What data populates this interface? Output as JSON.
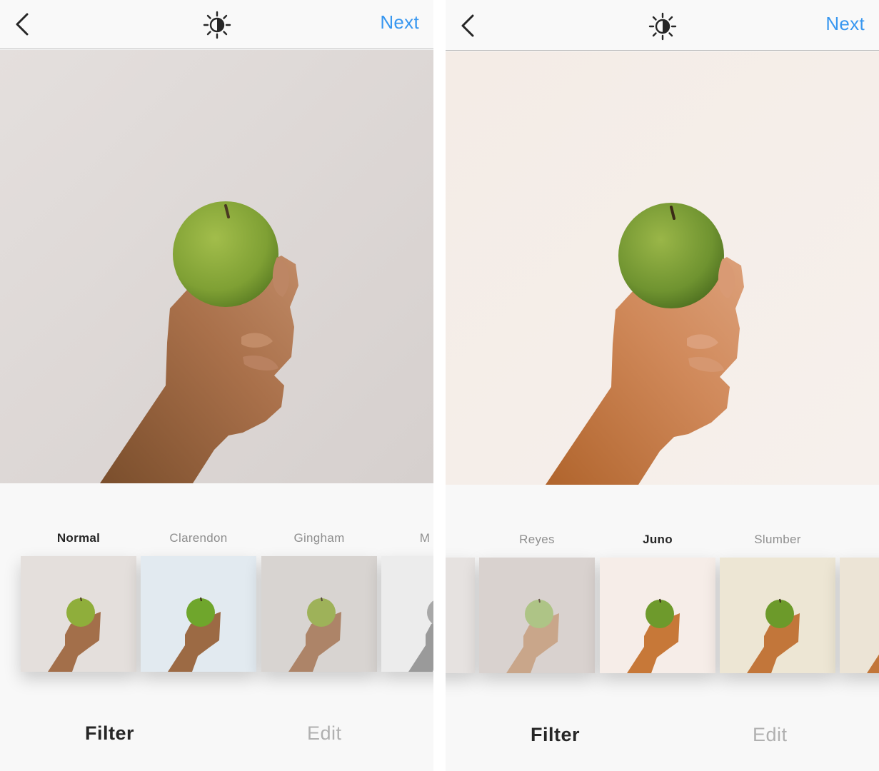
{
  "colors": {
    "accent": "#3897f0",
    "text_dark": "#262626",
    "text_muted": "#8e8e8e",
    "tab_inactive": "#b0b0b0"
  },
  "icons": {
    "back": "chevron-left-icon",
    "lux": "lux-sun-icon"
  },
  "screens": [
    {
      "header": {
        "next_label": "Next"
      },
      "filters": [
        {
          "name": "Normal",
          "selected": true,
          "tone": "normal"
        },
        {
          "name": "Clarendon",
          "selected": false,
          "tone": "clarendon"
        },
        {
          "name": "Gingham",
          "selected": false,
          "tone": "gingham"
        },
        {
          "name": "M",
          "selected": false,
          "tone": "bw"
        }
      ],
      "tabs": {
        "filter_label": "Filter",
        "edit_label": "Edit",
        "active": "Filter"
      }
    },
    {
      "header": {
        "next_label": "Next"
      },
      "filters": [
        {
          "name": "",
          "selected": false,
          "tone": "edge"
        },
        {
          "name": "Reyes",
          "selected": false,
          "tone": "reyes"
        },
        {
          "name": "Juno",
          "selected": true,
          "tone": "juno"
        },
        {
          "name": "Slumber",
          "selected": false,
          "tone": "slumber"
        },
        {
          "name": "",
          "selected": false,
          "tone": "edge2"
        }
      ],
      "tabs": {
        "filter_label": "Filter",
        "edit_label": "Edit",
        "active": "Filter"
      }
    }
  ]
}
